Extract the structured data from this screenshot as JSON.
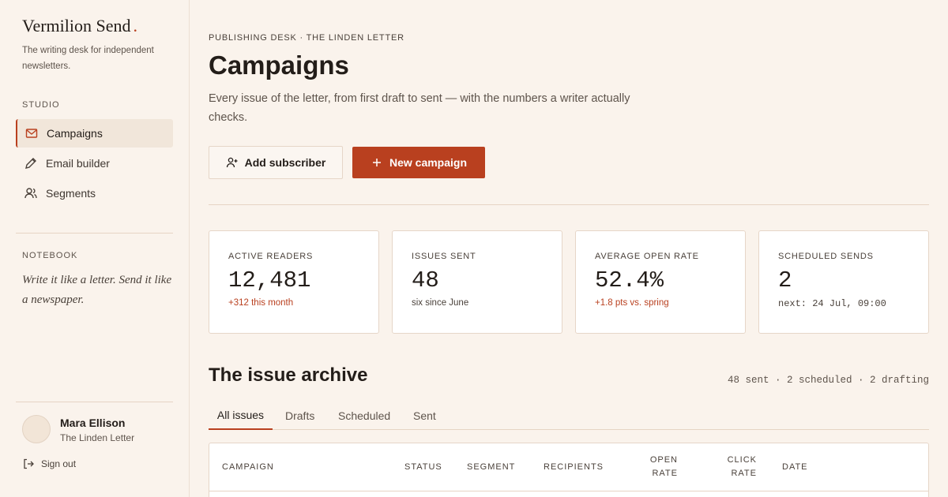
{
  "brand": {
    "name": "Vermilion Send",
    "dot": ".",
    "tagline": "The writing desk for independent newsletters."
  },
  "sidebar": {
    "studio_label": "STUDIO",
    "items": [
      {
        "label": "Campaigns",
        "icon": "mail-icon",
        "active": true
      },
      {
        "label": "Email builder",
        "icon": "pen-icon",
        "active": false
      },
      {
        "label": "Segments",
        "icon": "users-icon",
        "active": false
      }
    ],
    "notebook_label": "NOTEBOOK",
    "notebook_quote": "Write it like a letter. Send it like a newspaper."
  },
  "user": {
    "name": "Mara Ellison",
    "publication": "The Linden Letter",
    "sign_out": "Sign out"
  },
  "header": {
    "eyebrow": "PUBLISHING DESK · THE LINDEN LETTER",
    "title": "Campaigns",
    "lede": "Every issue of the letter, from first draft to sent — with the numbers a writer actually checks."
  },
  "actions": {
    "add_subscriber": "Add subscriber",
    "new_campaign": "New campaign"
  },
  "stats": [
    {
      "label": "ACTIVE READERS",
      "value": "12,481",
      "note": "+312 this month"
    },
    {
      "label": "ISSUES SENT",
      "value": "48",
      "note": "six since June"
    },
    {
      "label": "AVERAGE OPEN RATE",
      "value": "52.4%",
      "note": "+1.8 pts vs. spring"
    },
    {
      "label": "SCHEDULED SENDS",
      "value": "2",
      "note": "next: 24 Jul, 09:00"
    }
  ],
  "archive": {
    "title": "The issue archive",
    "summary": "48 sent · 2 scheduled · 2 drafting",
    "tabs": [
      {
        "label": "All issues",
        "active": true
      },
      {
        "label": "Drafts",
        "active": false
      },
      {
        "label": "Scheduled",
        "active": false
      },
      {
        "label": "Sent",
        "active": false
      }
    ],
    "columns": [
      "CAMPAIGN",
      "STATUS",
      "SEGMENT",
      "RECIPIENTS",
      "OPEN\nRATE",
      "CLICK\nRATE",
      "DATE"
    ]
  },
  "colors": {
    "accent": "#b9401f",
    "background": "#faf3ec",
    "card": "#ffffff",
    "border": "#e6d6c8"
  }
}
